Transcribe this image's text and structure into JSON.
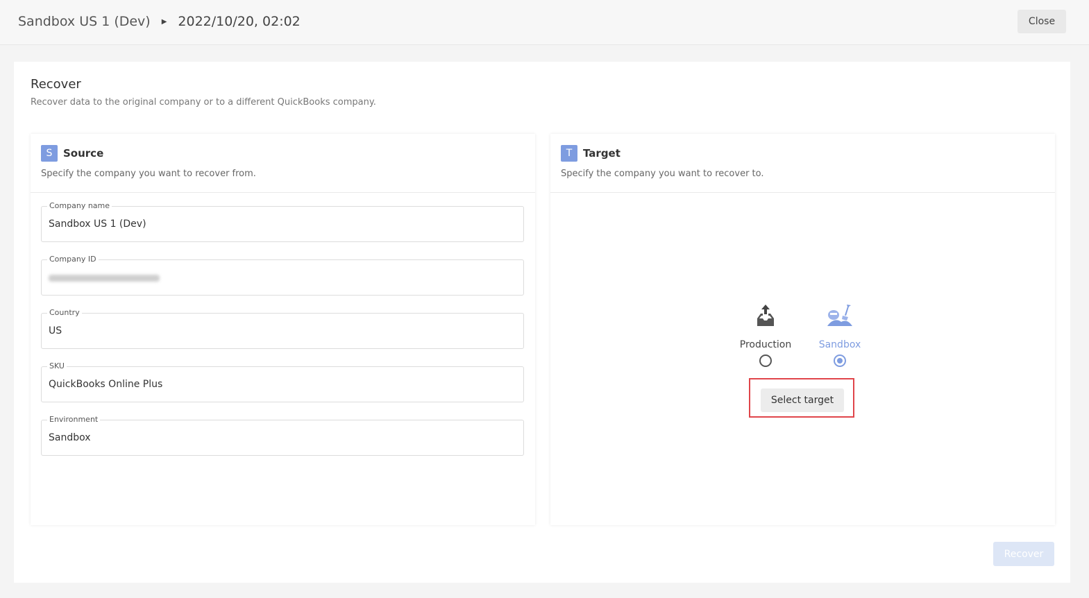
{
  "header": {
    "breadcrumb_company": "Sandbox US 1 (Dev)",
    "breadcrumb_date": "2022/10/20, 02:02",
    "close_label": "Close"
  },
  "recover": {
    "title": "Recover",
    "subtitle": "Recover data to the original company or to a different QuickBooks company."
  },
  "source": {
    "badge": "S",
    "title": "Source",
    "description": "Specify the company you want to recover from.",
    "fields": [
      {
        "label": "Company name",
        "value": "Sandbox US 1 (Dev)"
      },
      {
        "label": "Company ID",
        "value": ""
      },
      {
        "label": "Country",
        "value": "US"
      },
      {
        "label": "SKU",
        "value": "QuickBooks Online Plus"
      },
      {
        "label": "Environment",
        "value": "Sandbox"
      }
    ]
  },
  "target": {
    "badge": "T",
    "title": "Target",
    "description": "Specify the company you want to recover to.",
    "environments": [
      {
        "label": "Production",
        "icon": "inbox-upload-icon",
        "selected": false
      },
      {
        "label": "Sandbox",
        "icon": "sandbox-shovel-icon",
        "selected": true
      }
    ],
    "select_target_label": "Select target"
  },
  "footer": {
    "recover_label": "Recover"
  },
  "colors": {
    "accent": "#7e9ce0",
    "highlight": "#e0454a",
    "disabled_button": "#dde6f6"
  }
}
